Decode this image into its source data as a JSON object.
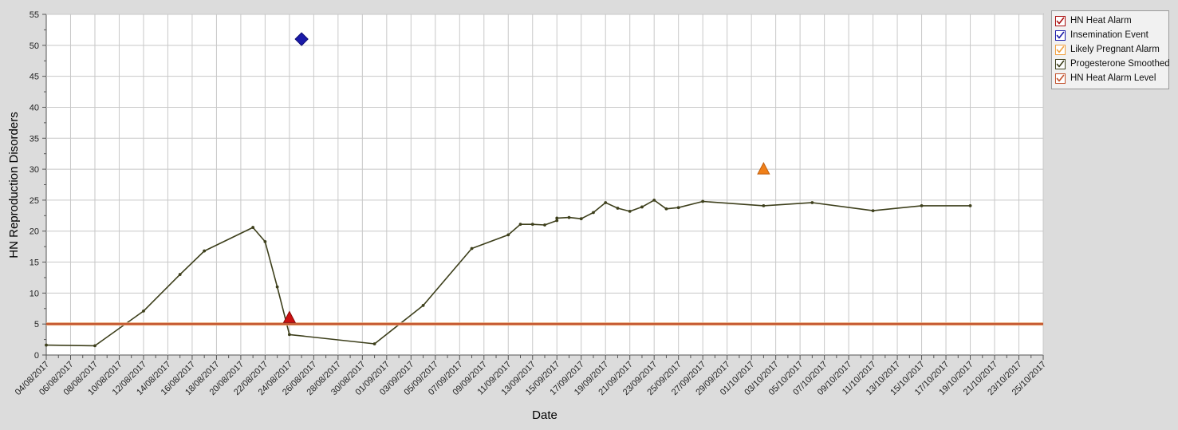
{
  "chart_data": {
    "type": "line",
    "title": "",
    "xlabel": "Date",
    "ylabel": "HN Reproduction Disorders",
    "ylim": [
      0,
      55
    ],
    "ytick_step": 5,
    "yticks": [
      0,
      5,
      10,
      15,
      20,
      25,
      30,
      35,
      40,
      45,
      50,
      55
    ],
    "grid": true,
    "legend_position": "top-right-outside",
    "x_start": "04/08/2017",
    "x_end": "25/10/2017",
    "xtick_interval_days": 2,
    "xticks": [
      "04/08/2017",
      "06/08/2017",
      "08/08/2017",
      "10/08/2017",
      "12/08/2017",
      "14/08/2017",
      "16/08/2017",
      "18/08/2017",
      "20/08/2017",
      "22/08/2017",
      "24/08/2017",
      "26/08/2017",
      "28/08/2017",
      "30/08/2017",
      "01/09/2017",
      "03/09/2017",
      "05/09/2017",
      "07/09/2017",
      "09/09/2017",
      "11/09/2017",
      "13/09/2017",
      "15/09/2017",
      "17/09/2017",
      "19/09/2017",
      "21/09/2017",
      "23/09/2017",
      "25/09/2017",
      "27/09/2017",
      "29/09/2017",
      "01/10/2017",
      "03/10/2017",
      "05/10/2017",
      "07/10/2017",
      "09/10/2017",
      "11/10/2017",
      "13/10/2017",
      "15/10/2017",
      "17/10/2017",
      "19/10/2017",
      "21/10/2017",
      "23/10/2017",
      "25/10/2017"
    ],
    "series": [
      {
        "name": "Progesterone Smoothed",
        "type": "line",
        "color": "#3d3f1b",
        "marker": "circle",
        "points": [
          {
            "x": "04/08/2017",
            "y": 1.6
          },
          {
            "x": "08/08/2017",
            "y": 1.5
          },
          {
            "x": "12/08/2017",
            "y": 7.1
          },
          {
            "x": "15/08/2017",
            "y": 13.0
          },
          {
            "x": "17/08/2017",
            "y": 16.8
          },
          {
            "x": "21/08/2017",
            "y": 20.6
          },
          {
            "x": "22/08/2017",
            "y": 18.3
          },
          {
            "x": "23/08/2017",
            "y": 11.0
          },
          {
            "x": "24/08/2017",
            "y": 3.3
          },
          {
            "x": "31/08/2017",
            "y": 1.8
          },
          {
            "x": "04/09/2017",
            "y": 8.0
          },
          {
            "x": "08/09/2017",
            "y": 17.2
          },
          {
            "x": "11/09/2017",
            "y": 19.4
          },
          {
            "x": "12/09/2017",
            "y": 21.1
          },
          {
            "x": "13/09/2017",
            "y": 21.1
          },
          {
            "x": "14/09/2017",
            "y": 21.0
          },
          {
            "x": "15/09/2017",
            "y": 21.7
          },
          {
            "x": "15/09/2017",
            "y": 22.1
          },
          {
            "x": "16/09/2017",
            "y": 22.2
          },
          {
            "x": "17/09/2017",
            "y": 22.0
          },
          {
            "x": "18/09/2017",
            "y": 23.0
          },
          {
            "x": "19/09/2017",
            "y": 24.6
          },
          {
            "x": "20/09/2017",
            "y": 23.7
          },
          {
            "x": "21/09/2017",
            "y": 23.2
          },
          {
            "x": "22/09/2017",
            "y": 23.9
          },
          {
            "x": "23/09/2017",
            "y": 25.0
          },
          {
            "x": "24/09/2017",
            "y": 23.6
          },
          {
            "x": "25/09/2017",
            "y": 23.8
          },
          {
            "x": "27/09/2017",
            "y": 24.8
          },
          {
            "x": "02/10/2017",
            "y": 24.1
          },
          {
            "x": "06/10/2017",
            "y": 24.6
          },
          {
            "x": "11/10/2017",
            "y": 23.3
          },
          {
            "x": "15/10/2017",
            "y": 24.1
          },
          {
            "x": "19/10/2017",
            "y": 24.1
          }
        ]
      },
      {
        "name": "HN Heat Alarm Level",
        "type": "hline",
        "color": "#c2512c",
        "y": 5
      },
      {
        "name": "Insemination Event",
        "type": "scatter",
        "color": "#1a1aa8",
        "marker": "diamond",
        "points": [
          {
            "x": "25/08/2017",
            "y": 51.0
          }
        ]
      },
      {
        "name": "HN Heat Alarm",
        "type": "scatter",
        "color": "#cc1111",
        "marker": "triangle",
        "points": [
          {
            "x": "24/08/2017",
            "y": 6.0
          }
        ]
      },
      {
        "name": "Likely Pregnant Alarm",
        "type": "scatter",
        "color": "#f08019",
        "marker": "triangle",
        "points": [
          {
            "x": "02/10/2017",
            "y": 30.0
          }
        ]
      }
    ]
  },
  "legend": {
    "items": [
      {
        "label": "HN Heat Alarm",
        "color": "#aa1111",
        "checked": true
      },
      {
        "label": "Insemination Event",
        "color": "#1a1aa8",
        "checked": true
      },
      {
        "label": "Likely Pregnant Alarm",
        "color": "#f0a040",
        "checked": true
      },
      {
        "label": "Progesterone Smoothed",
        "color": "#3d3f1b",
        "checked": true
      },
      {
        "label": "HN Heat Alarm Level",
        "color": "#c2512c",
        "checked": true
      }
    ]
  },
  "axes": {
    "y_title": "HN Reproduction Disorders",
    "x_title": "Date"
  },
  "colors": {
    "background": "#dcdcdc",
    "plot_background": "#ffffff",
    "grid": "#c8c8c8",
    "axis": "#555555",
    "progesterone": "#3d3f1b",
    "alarm_level": "#c2512c",
    "insemination": "#1a1aa8",
    "heat_alarm": "#cc1111",
    "pregnant_alarm": "#f08019"
  }
}
